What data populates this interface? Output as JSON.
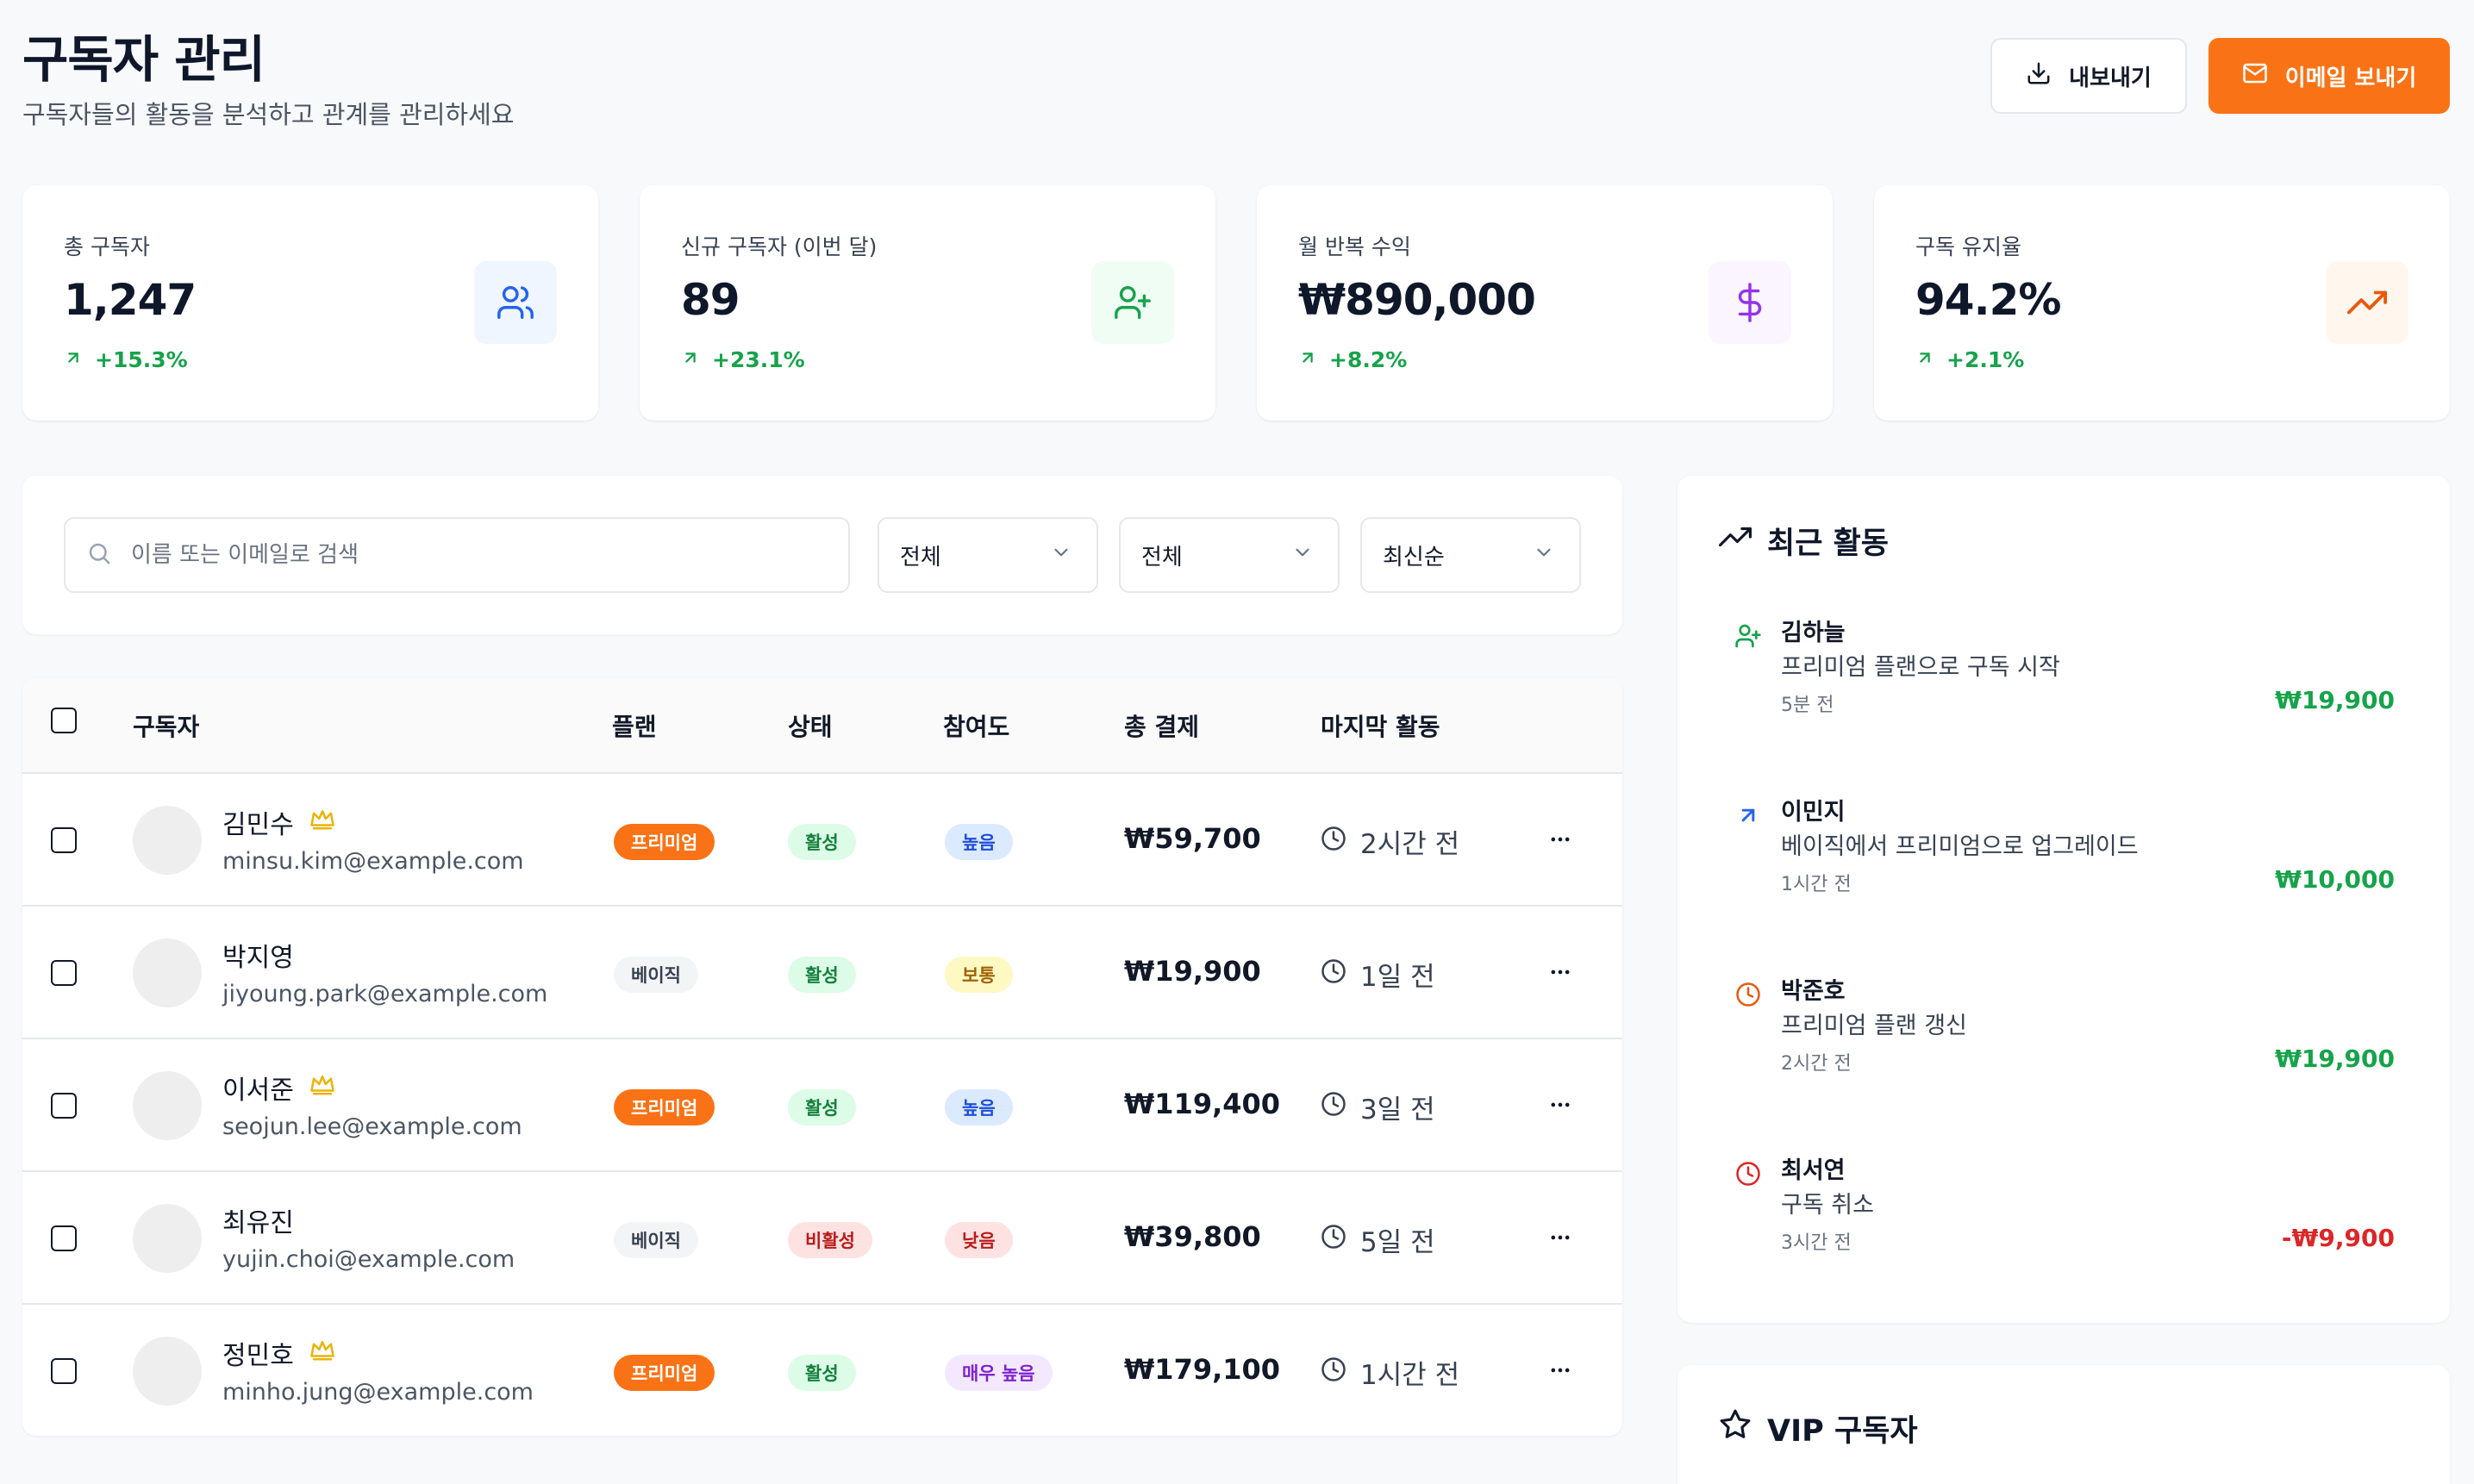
{
  "header": {
    "title": "구독자 관리",
    "subtitle": "구독자들의 활동을 분석하고 관계를 관리하세요",
    "export_label": "내보내기",
    "email_label": "이메일 보내기"
  },
  "stats": [
    {
      "label": "총 구독자",
      "value": "1,247",
      "change": "+15.3%",
      "icon": "users-icon",
      "icon_color": "#2563eb",
      "icon_bg": "#eff6ff"
    },
    {
      "label": "신규 구독자 (이번 달)",
      "value": "89",
      "change": "+23.1%",
      "icon": "user-plus-icon",
      "icon_color": "#16a34a",
      "icon_bg": "#f0fdf4"
    },
    {
      "label": "월 반복 수익",
      "value": "₩890,000",
      "change": "+8.2%",
      "icon": "dollar-icon",
      "icon_color": "#9333ea",
      "icon_bg": "#faf5ff"
    },
    {
      "label": "구독 유지율",
      "value": "94.2%",
      "change": "+2.1%",
      "icon": "trending-up-icon",
      "icon_color": "#ea580c",
      "icon_bg": "#fff7ed"
    }
  ],
  "filters": {
    "search_placeholder": "이름 또는 이메일로 검색",
    "select1": "전체",
    "select2": "전체",
    "select3": "최신순"
  },
  "table": {
    "headers": {
      "subscriber": "구독자",
      "plan": "플랜",
      "status": "상태",
      "engagement": "참여도",
      "total": "총 결제",
      "last": "마지막 활동"
    },
    "rows": [
      {
        "name": "김민수",
        "email": "minsu.kim@example.com",
        "vip": true,
        "plan": "프리미엄",
        "status": "활성",
        "engagement": "높음",
        "total": "₩59,700",
        "last": "2시간 전"
      },
      {
        "name": "박지영",
        "email": "jiyoung.park@example.com",
        "vip": false,
        "plan": "베이직",
        "status": "활성",
        "engagement": "보통",
        "total": "₩19,900",
        "last": "1일 전"
      },
      {
        "name": "이서준",
        "email": "seojun.lee@example.com",
        "vip": true,
        "plan": "프리미엄",
        "status": "활성",
        "engagement": "높음",
        "total": "₩119,400",
        "last": "3일 전"
      },
      {
        "name": "최유진",
        "email": "yujin.choi@example.com",
        "vip": false,
        "plan": "베이직",
        "status": "비활성",
        "engagement": "낮음",
        "total": "₩39,800",
        "last": "5일 전"
      },
      {
        "name": "정민호",
        "email": "minho.jung@example.com",
        "vip": true,
        "plan": "프리미엄",
        "status": "활성",
        "engagement": "매우 높음",
        "total": "₩179,100",
        "last": "1시간 전"
      }
    ]
  },
  "activity": {
    "title": "최근 활동",
    "items": [
      {
        "name": "김하늘",
        "desc": "프리미엄 플랜으로 구독 시작",
        "time": "5분 전",
        "amount": "₩19,900",
        "icon": "user-plus-icon",
        "icon_color": "#16a34a",
        "amount_color": "#16a34a"
      },
      {
        "name": "이민지",
        "desc": "베이직에서 프리미엄으로 업그레이드",
        "time": "1시간 전",
        "amount": "₩10,000",
        "icon": "arrow-up-right-icon",
        "icon_color": "#2563eb",
        "amount_color": "#16a34a"
      },
      {
        "name": "박준호",
        "desc": "프리미엄 플랜 갱신",
        "time": "2시간 전",
        "amount": "₩19,900",
        "icon": "clock-icon",
        "icon_color": "#ea580c",
        "amount_color": "#16a34a"
      },
      {
        "name": "최서연",
        "desc": "구독 취소",
        "time": "3시간 전",
        "amount": "-₩9,900",
        "icon": "clock-icon",
        "icon_color": "#dc2626",
        "amount_color": "#dc2626"
      }
    ]
  },
  "vip": {
    "title": "VIP 구독자"
  }
}
